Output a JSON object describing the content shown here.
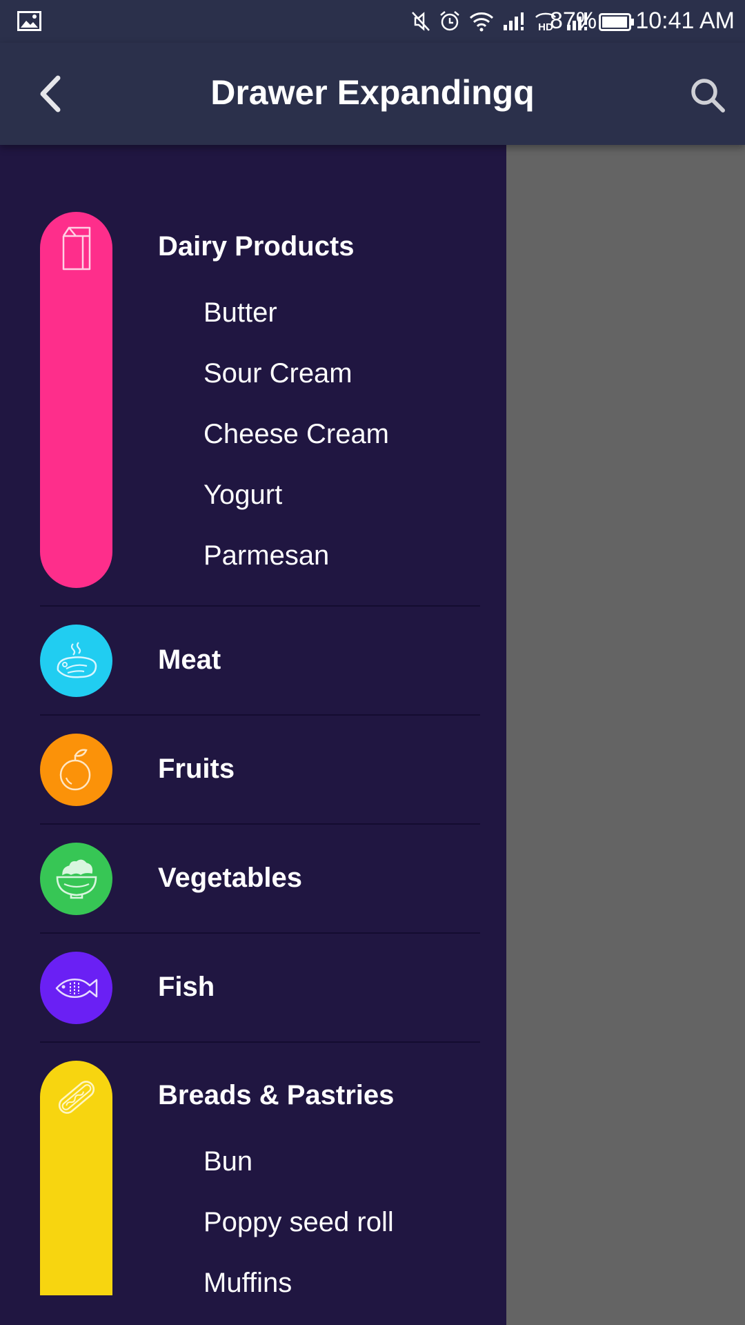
{
  "status_bar": {
    "battery_percent": "87%",
    "time": "10:41 AM",
    "icons": [
      "image-icon",
      "mute-icon",
      "alarm-icon",
      "wifi-icon",
      "signal-icon",
      "hd-icon",
      "signal-icon",
      "battery-icon"
    ]
  },
  "app_bar": {
    "title": "Drawer Expandingq",
    "back_icon": "chevron-left-icon",
    "search_icon": "search-icon"
  },
  "drawer": {
    "categories": [
      {
        "label": "Dairy Products",
        "icon": "milk-carton-icon",
        "color": "#fe2e8b",
        "expanded": true,
        "items": [
          "Butter",
          "Sour Cream",
          "Cheese Cream",
          "Yogurt",
          "Parmesan"
        ]
      },
      {
        "label": "Meat",
        "icon": "steak-icon",
        "color": "#21cdf1",
        "expanded": false
      },
      {
        "label": "Fruits",
        "icon": "orange-icon",
        "color": "#fb9209",
        "expanded": false
      },
      {
        "label": "Vegetables",
        "icon": "salad-bowl-icon",
        "color": "#37c655",
        "expanded": false
      },
      {
        "label": "Fish",
        "icon": "fish-icon",
        "color": "#6a20f4",
        "expanded": false
      },
      {
        "label": "Breads & Pastries",
        "icon": "hotdog-icon",
        "color": "#f7d510",
        "expanded": true,
        "items": [
          "Bun",
          "Poppy seed roll",
          "Muffins"
        ]
      }
    ]
  },
  "colors": {
    "app_bar": "#2b304b",
    "drawer_bg": "#201641",
    "scrim": "#646464"
  }
}
